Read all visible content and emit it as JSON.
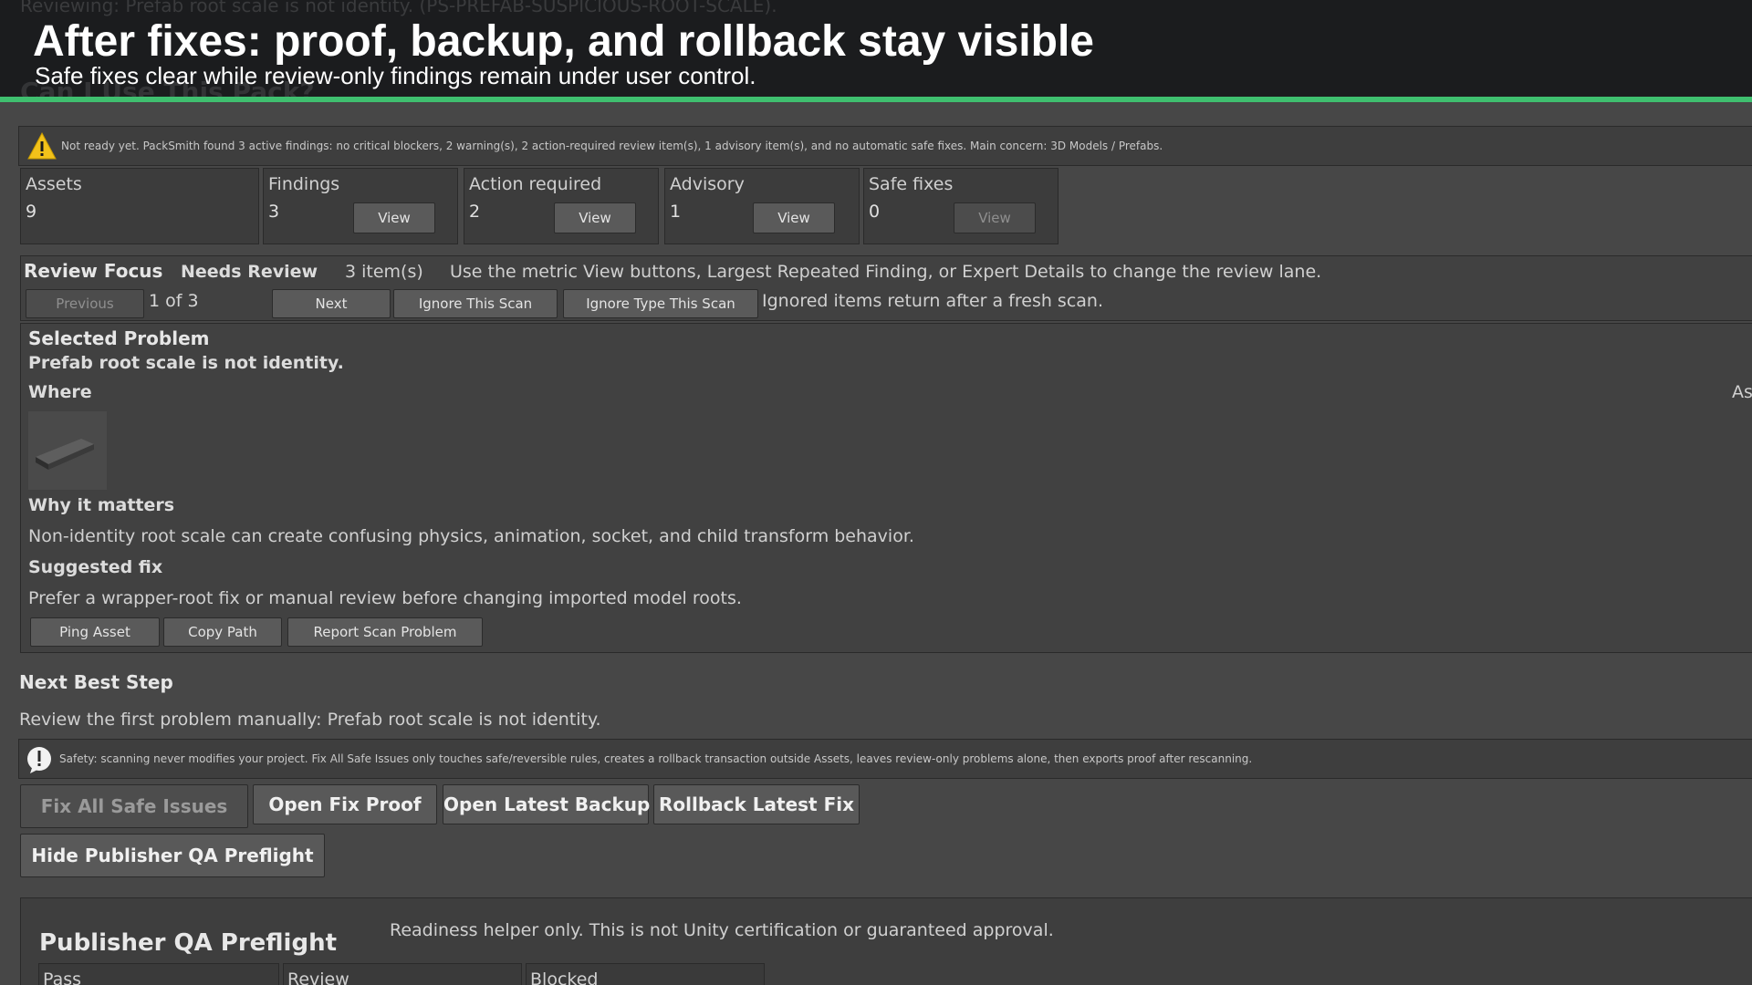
{
  "banner": {
    "ghost_top": "Reviewing: Prefab root scale is not identity. (PS-PREFAB-SUSPICIOUS-ROOT-SCALE).",
    "ghost_bottom": "Can I Use This Pack?",
    "title": "After fixes: proof, backup, and rollback stay visible",
    "subtitle": "Safe fixes clear while review-only findings remain under user control.",
    "accent_color": "#3fbf6f"
  },
  "status_bar": {
    "icon": "warning-triangle-icon",
    "text": "Not ready yet. PackSmith found 3 active findings: no critical blockers, 2 warning(s), 2 action-required review item(s), 1 advisory item(s), and no automatic safe fixes. Main concern: 3D Models / Prefabs."
  },
  "metrics": {
    "assets": {
      "label": "Assets",
      "value": "9"
    },
    "findings": {
      "label": "Findings",
      "value": "3",
      "button": "View"
    },
    "action_required": {
      "label": "Action required",
      "value": "2",
      "button": "View"
    },
    "advisory": {
      "label": "Advisory",
      "value": "1",
      "button": "View"
    },
    "safe_fixes": {
      "label": "Safe fixes",
      "value": "0",
      "button": "View"
    }
  },
  "review_focus": {
    "title": "Review Focus",
    "lane": "Needs Review",
    "count": "3 item(s)",
    "hint": "Use the metric View buttons, Largest Repeated Finding, or Expert Details to change the review lane.",
    "previous": "Previous",
    "position": "1 of 3",
    "next": "Next",
    "ignore_scan": "Ignore This Scan",
    "ignore_type": "Ignore Type This Scan",
    "ignore_note": "Ignored items return after a fresh scan."
  },
  "problem": {
    "heading": "Selected Problem",
    "name": "Prefab root scale is not identity.",
    "where_label": "Where",
    "right_clip": "As",
    "why_label": "Why it matters",
    "why_text": "Non-identity root scale can create confusing physics, animation, socket, and child transform behavior.",
    "fix_label": "Suggested fix",
    "fix_text": "Prefer a wrapper-root fix or manual review before changing imported model roots.",
    "ping": "Ping Asset",
    "copy": "Copy Path",
    "report": "Report Scan Problem"
  },
  "next_step": {
    "heading": "Next Best Step",
    "text": "Review the first problem manually: Prefab root scale is not identity."
  },
  "safety": {
    "icon": "exclamation-circle-icon",
    "text": "Safety: scanning never modifies your project. Fix All Safe Issues only touches safe/reversible rules, creates a rollback transaction outside Assets, leaves review-only problems alone, then exports proof after rescanning."
  },
  "actions": {
    "fix_all": "Fix All Safe Issues",
    "open_proof": "Open Fix Proof",
    "open_backup": "Open Latest Backup",
    "rollback": "Rollback Latest Fix",
    "hide_qa": "Hide Publisher QA Preflight"
  },
  "qa": {
    "title": "Publisher QA Preflight",
    "note": "Readiness helper only. This is not Unity certification or guaranteed approval.",
    "columns": [
      "Pass",
      "Review",
      "Blocked"
    ]
  }
}
